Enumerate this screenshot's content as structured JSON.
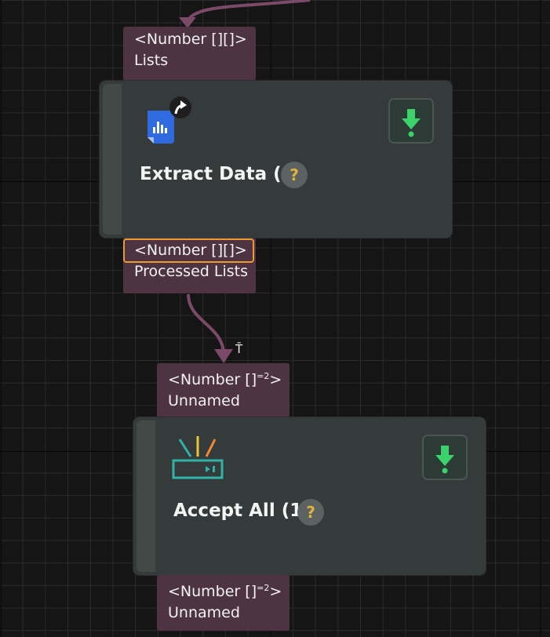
{
  "nodes": [
    {
      "title": "Extract Data (1)",
      "icon": "chart-document-icon",
      "badge_icon": "curved-arrow-up-icon",
      "run_icon": "download-arrow-icon",
      "help_label": "?",
      "input_port": {
        "type": "<Number [][]>",
        "name": "Lists"
      },
      "output_port": {
        "type": "<Number [][]>",
        "name": "Processed Lists",
        "selected": true
      }
    },
    {
      "title": "Accept All (1)",
      "icon": "router-antenna-icon",
      "run_icon": "download-arrow-icon",
      "help_label": "?",
      "input_port": {
        "type_main": "<Number []",
        "type_sup": "=2",
        "type_end": ">",
        "name": "Unnamed"
      },
      "output_port": {
        "type_main": "<Number []",
        "type_sup": "=2",
        "type_end": ">",
        "name": "Unnamed"
      }
    }
  ],
  "connection_marker": "T̄",
  "colors": {
    "canvas_bg": "#151515",
    "node_bg": "#353a3b",
    "port_bg": "#4e3442",
    "connection": "#7a4a68",
    "selection": "#ee9a2c",
    "run_icon": "#3bd26b",
    "help_text": "#e2b33c"
  }
}
